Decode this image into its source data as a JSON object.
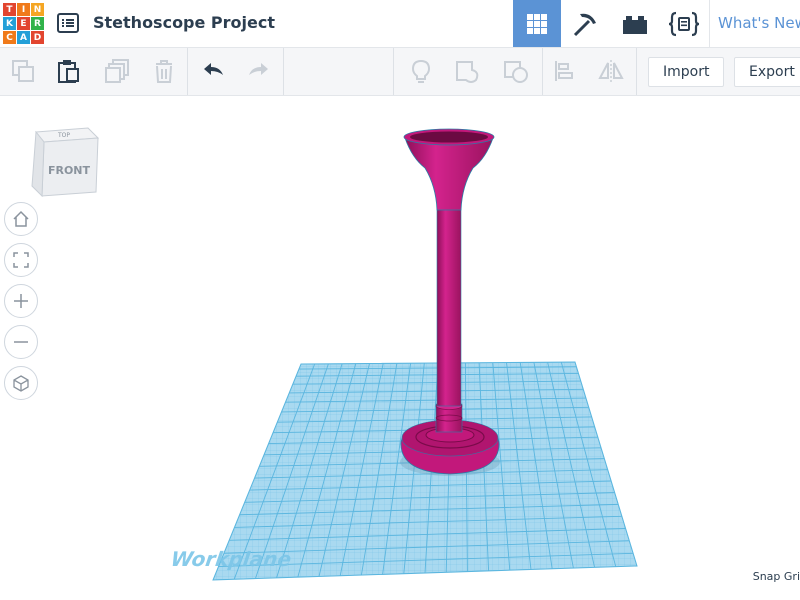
{
  "app": {
    "logo_letters": [
      "T",
      "I",
      "N",
      "K",
      "E",
      "R",
      "C",
      "A",
      "D"
    ],
    "logo_colors": [
      "#e2452f",
      "#f07a1a",
      "#f5a623",
      "#24a0d8",
      "#e2452f",
      "#31b34a",
      "#f07a1a",
      "#24a0d8",
      "#e2452f"
    ]
  },
  "header": {
    "project_title": "Stethoscope Project",
    "whats_new": "What's New",
    "modes": [
      {
        "name": "3d-design-view",
        "icon": "grid-icon",
        "active": true
      },
      {
        "name": "codeblocks",
        "icon": "pickaxe-icon",
        "active": false
      },
      {
        "name": "bricks",
        "icon": "brick-icon",
        "active": false
      },
      {
        "name": "lesson",
        "icon": "curly-braces-icon",
        "active": false
      }
    ]
  },
  "toolbar": {
    "import_label": "Import",
    "export_label": "Export",
    "icons": [
      "copy-icon",
      "paste-icon",
      "duplicate-icon",
      "delete-icon",
      "undo-icon",
      "redo-icon",
      "lightbulb-icon",
      "group-icon",
      "ungroup-icon",
      "align-icon",
      "mirror-icon"
    ]
  },
  "viewport": {
    "viewcube_top": "TOP",
    "viewcube_front": "FRONT",
    "workplane_label": "Workplane",
    "snap_grid_label": "Snap Gri",
    "nav_buttons": [
      "home-icon",
      "fit-view-icon",
      "zoom-in-icon",
      "zoom-out-icon",
      "perspective-icon"
    ],
    "colors": {
      "workplane": "#a9d9f0",
      "workplane_lines": "#5bb6df",
      "object": "#c2187b",
      "object_dark": "#8e0f59",
      "accent": "#5b93d5"
    }
  }
}
